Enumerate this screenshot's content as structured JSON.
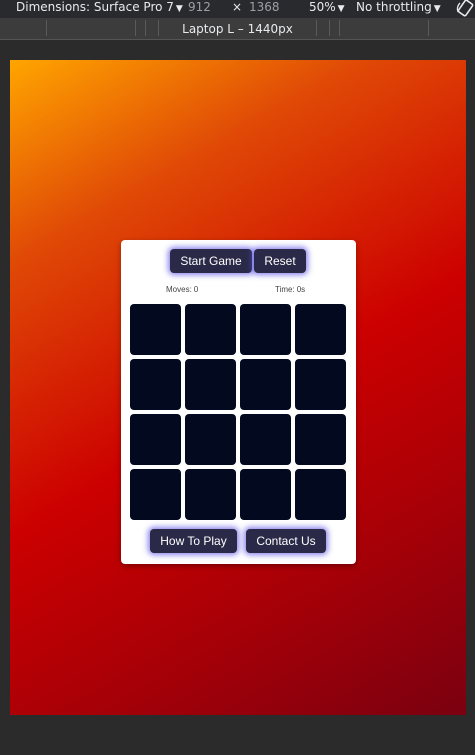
{
  "devtools": {
    "dimensions_label": "Dimensions: Surface Pro 7",
    "width": "912",
    "times": "×",
    "height": "1368",
    "zoom": "50%",
    "throttling": "No throttling",
    "caret": "▼",
    "rotate_icon": "rotate-icon",
    "breakpoint_label": "Laptop L – 1440px"
  },
  "game": {
    "start_label": "Start Game",
    "reset_label": "Reset",
    "moves_label": "Moves:",
    "moves_value": "0",
    "time_label": "Time:",
    "time_value": "0s",
    "how_to_play_label": "How To Play",
    "contact_label": "Contact Us",
    "tile_color": "#03091e",
    "button_color": "#2a2a48",
    "glow_color": "#5a50e6",
    "tile_count": 16
  },
  "colors": {
    "gradient_start": "#ffa500",
    "gradient_mid": "#cc0000",
    "gradient_end": "#7a0010"
  }
}
